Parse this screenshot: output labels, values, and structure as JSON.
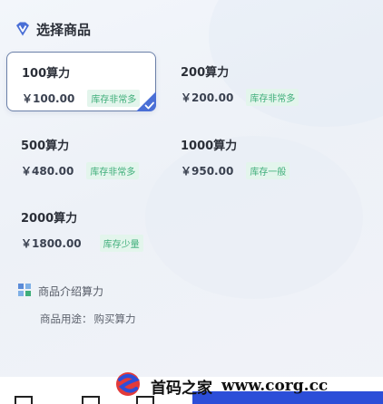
{
  "section": {
    "title": "选择商品",
    "icon": "v-diamond-icon"
  },
  "products": [
    {
      "name": "100算力",
      "price": "￥100.00",
      "stock": "库存非常多",
      "selected": true
    },
    {
      "name": "200算力",
      "price": "￥200.00",
      "stock": "库存非常多",
      "selected": false
    },
    {
      "name": "500算力",
      "price": "￥480.00",
      "stock": "库存非常多",
      "selected": false
    },
    {
      "name": "1000算力",
      "price": "￥950.00",
      "stock": "库存一般",
      "selected": false
    },
    {
      "name": "2000算力",
      "price": "￥1800.00",
      "stock": "库存少量",
      "selected": false
    }
  ],
  "intro": {
    "title": "商品介绍算力",
    "usage_label": "商品用途：",
    "usage_value": "购买算力",
    "icon": "grid-icon"
  },
  "watermark": {
    "name": "首码之家",
    "url": "www.corg.cc"
  },
  "colors": {
    "accent": "#4a6fd6",
    "selected_border": "#6a7fa8",
    "stock_text": "#3fae7a",
    "stock_bg": "#e3f5ec"
  }
}
